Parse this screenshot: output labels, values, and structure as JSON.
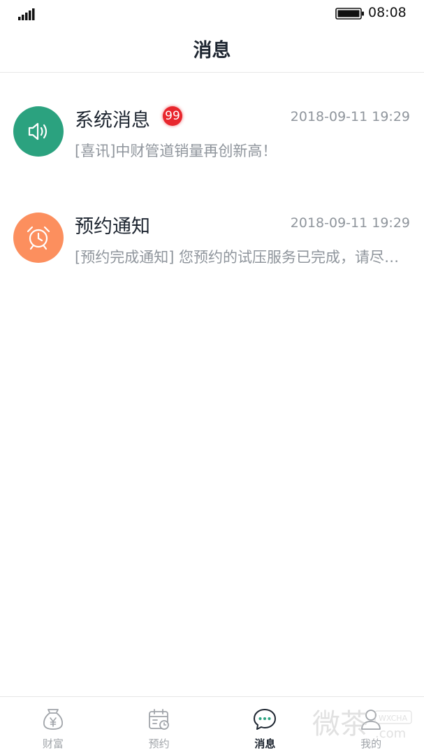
{
  "status_bar": {
    "time": "08:08"
  },
  "nav": {
    "title": "消息"
  },
  "messages": [
    {
      "title": "系统消息",
      "badge": "99",
      "time": "2018-09-11 19:29",
      "preview": "[喜讯]中财管道销量再创新高！",
      "icon": "speaker-icon",
      "color": "#2ba27f"
    },
    {
      "title": "预约通知",
      "time": "2018-09-11 19:29",
      "preview": "[预约完成通知] 您预约的试压服务已完成，请尽快前往确认",
      "icon": "alarm-clock-icon",
      "color": "#fc8f5e"
    }
  ],
  "tabs": [
    {
      "label": "财富",
      "icon": "money-bag-icon",
      "active": false
    },
    {
      "label": "预约",
      "icon": "calendar-clock-icon",
      "active": false
    },
    {
      "label": "消息",
      "icon": "chat-bubble-icon",
      "active": true
    },
    {
      "label": "我的",
      "icon": "user-icon",
      "active": false
    }
  ],
  "colors": {
    "active_tab": "#1d2530",
    "inactive_tab": "#a0a4a9",
    "badge": "#e8262d"
  },
  "watermark": {
    "text": "微茶",
    "sub": "WXCHA",
    "domain": ".com"
  }
}
